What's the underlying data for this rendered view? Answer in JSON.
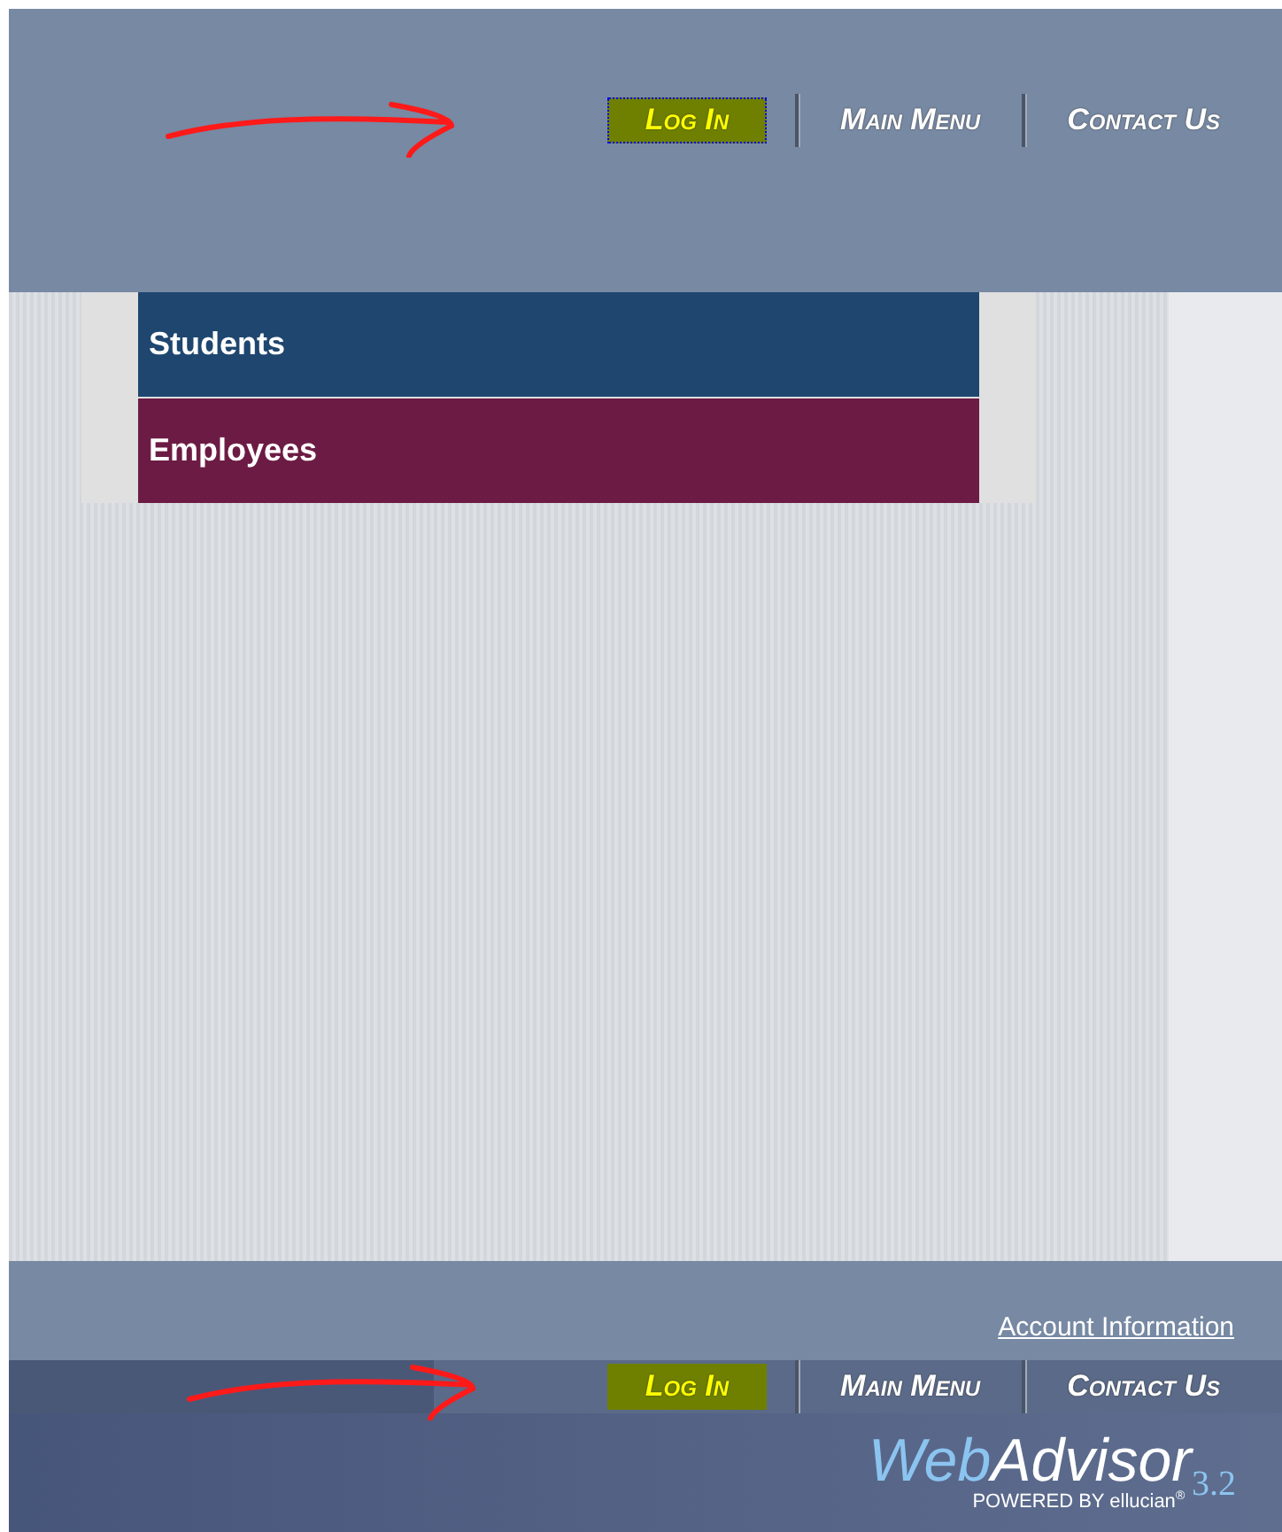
{
  "header_nav": [
    {
      "label": "Log In",
      "highlighted": true,
      "focused": true
    },
    {
      "label": "Main Menu",
      "highlighted": false,
      "focused": false
    },
    {
      "label": "Contact Us",
      "highlighted": false,
      "focused": false
    }
  ],
  "menu": [
    {
      "label": "Students",
      "color": "#1e466f"
    },
    {
      "label": "Employees",
      "color": "#6c1c44"
    }
  ],
  "footer": {
    "link": "Account Information",
    "nav": [
      {
        "label": "Log In",
        "highlighted": true
      },
      {
        "label": "Main Menu",
        "highlighted": false
      },
      {
        "label": "Contact Us",
        "highlighted": false
      }
    ],
    "logo": {
      "part_a": "Web",
      "part_b": "Advisor",
      "version": "3.2",
      "tagline": "POWERED BY ellucian",
      "mark": "®"
    }
  }
}
